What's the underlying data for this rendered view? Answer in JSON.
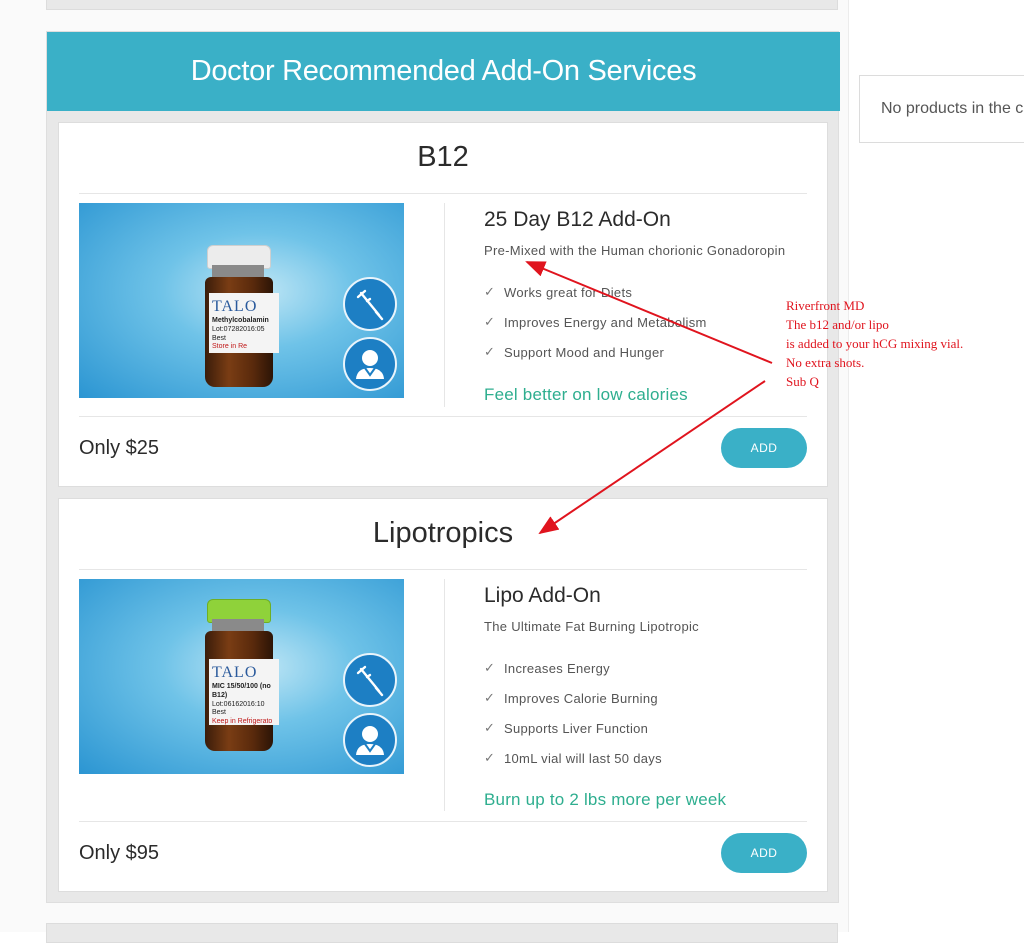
{
  "section": {
    "title": "Doctor Recommended Add-On Services"
  },
  "cart": {
    "message": "No products in the cart."
  },
  "colors": {
    "accent": "#3ab0c7",
    "tagline": "#2eae8f",
    "annotation": "#e0141e"
  },
  "products": [
    {
      "heading": "B12",
      "name": "25 Day B12 Add-On",
      "subtitle": "Pre-Mixed with the Human chorionic Gonadoropin",
      "features": [
        "Works great for Diets",
        "Improves Energy and Metabolism",
        "Support Mood and Hunger"
      ],
      "tagline": "Feel better on low calories",
      "price": "Only $25",
      "button": "ADD",
      "image": {
        "brand": "TALO",
        "label_line1": "Methylcobalamin",
        "label_line2": "Lot:07282016:05 Best",
        "label_line3": "Store in Re",
        "cap_color": "#eeeeee",
        "icons": [
          "syringe-icon",
          "doctor-icon"
        ]
      }
    },
    {
      "heading": "Lipotropics",
      "name": "Lipo Add-On",
      "subtitle": "The Ultimate Fat Burning Lipotropic",
      "features": [
        "Increases Energy",
        "Improves Calorie Burning",
        "Supports Liver Function",
        "10mL vial will last 50 days"
      ],
      "tagline": "Burn up to 2 lbs more per week",
      "price": "Only $95",
      "button": "ADD",
      "image": {
        "brand": "TALO",
        "label_line1": "MIC 15/50/100 (no B12)",
        "label_line2": "Lot:06162016:10 Best",
        "label_line3": "Keep in Refrigerato",
        "cap_color": "#8fd23a",
        "icons": [
          "syringe-icon",
          "doctor-icon"
        ]
      }
    }
  ],
  "annotation": {
    "lines": [
      "Riverfront MD",
      "The b12 and/or lipo",
      "is added to your hCG mixing vial.",
      "No extra shots.",
      "Sub Q"
    ]
  }
}
